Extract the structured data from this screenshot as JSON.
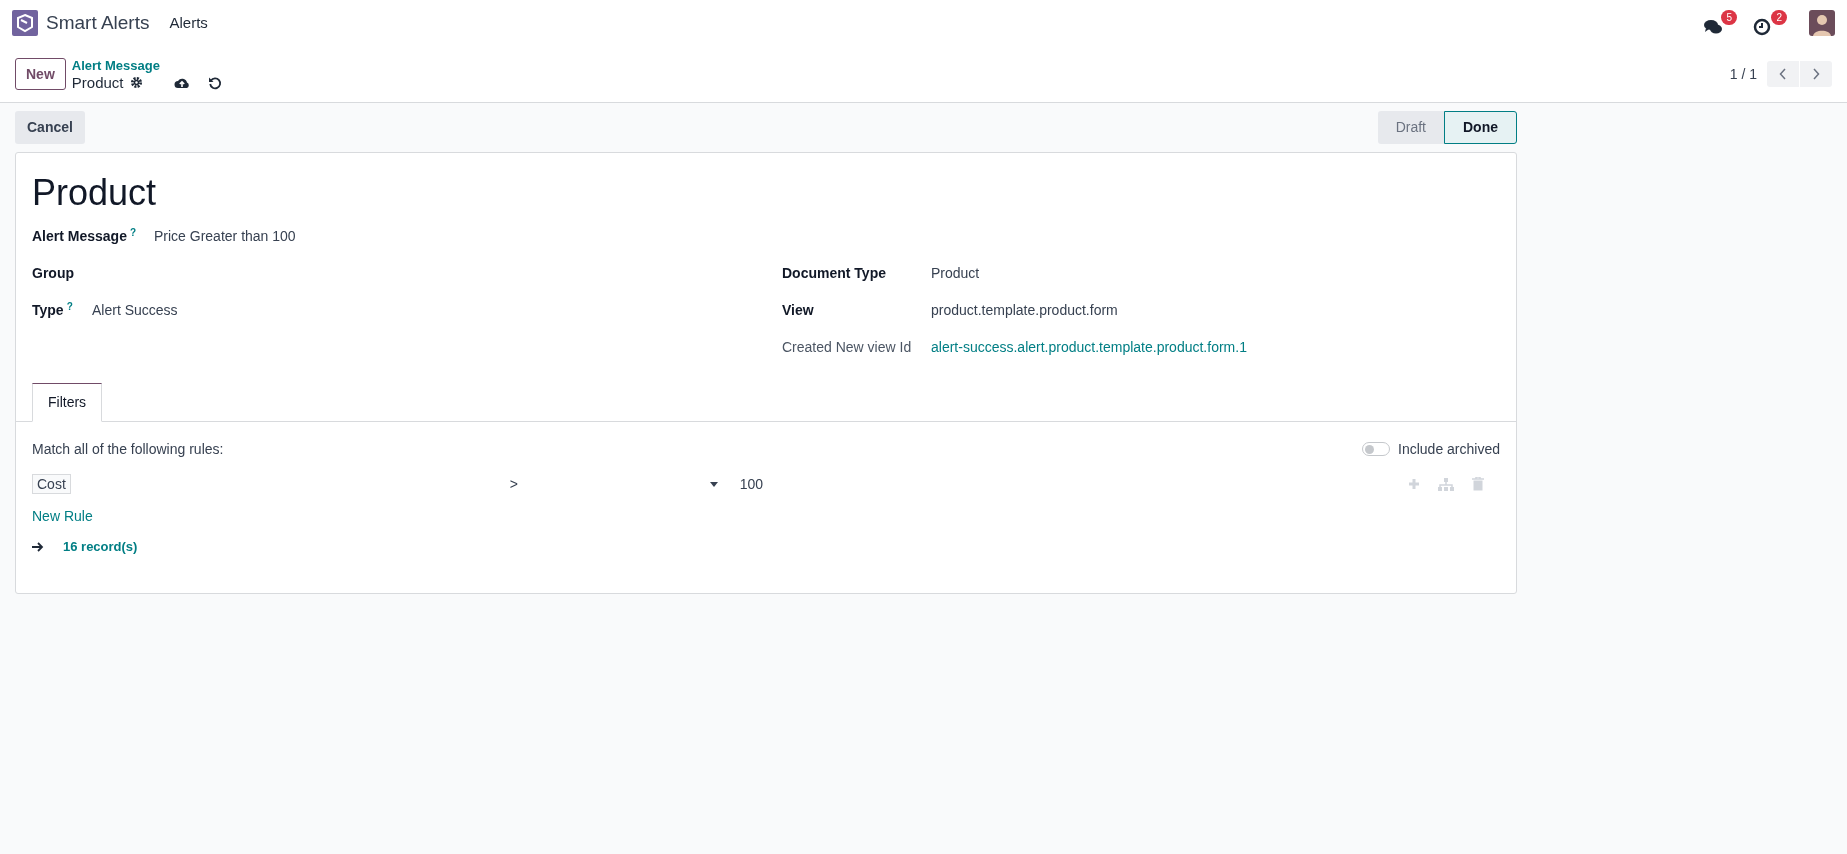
{
  "navbar": {
    "app_name": "Smart Alerts",
    "menu": [
      "Alerts"
    ],
    "messages_badge": "5",
    "activities_badge": "2"
  },
  "control_panel": {
    "new_button": "New",
    "breadcrumb": "Alert Message",
    "record_name": "Product",
    "pager": "1 / 1"
  },
  "actions": {
    "cancel": "Cancel"
  },
  "statusbar": [
    {
      "label": "Draft",
      "selected": false
    },
    {
      "label": "Done",
      "selected": true
    }
  ],
  "form": {
    "title": "Product",
    "alert_message": {
      "label": "Alert Message",
      "help": "?",
      "value": "Price Greater than 100"
    },
    "left_fields": [
      {
        "label": "Group"
      },
      {
        "label": "Type",
        "help": "?",
        "value": "Alert Success"
      }
    ],
    "right_fields": [
      {
        "label": "Document Type",
        "kind": "bold",
        "value": "Product",
        "link": false
      },
      {
        "label": "View",
        "kind": "bold",
        "value": "product.template.product.form",
        "link": false
      },
      {
        "label": "Created New view Id",
        "kind": "muted",
        "value": "alert-success.alert.product.template.product.form.1",
        "link": true
      }
    ],
    "tabs": [
      {
        "label": "Filters",
        "selected": true
      }
    ],
    "filters": {
      "intro": "Match all of the following rules:",
      "include_archived": {
        "label": "Include archived",
        "on": false
      },
      "rules": [
        {
          "field": "Cost",
          "operator": ">",
          "value": "100"
        }
      ],
      "new_rule": "New Rule",
      "records": "16 record(s)"
    }
  }
}
